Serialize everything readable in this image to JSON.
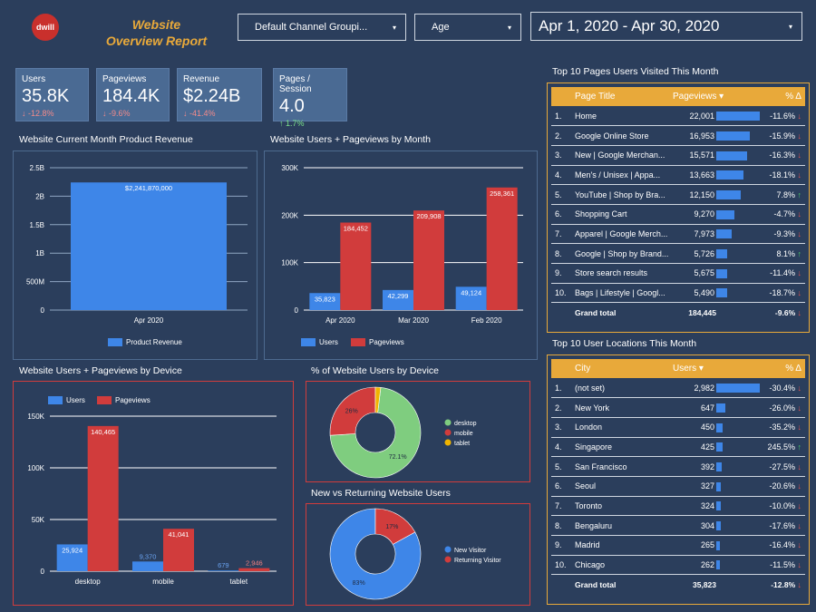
{
  "header": {
    "logo_text": "dwill",
    "title_line1": "Website",
    "title_line2": "Overview Report",
    "filter1": "Default Channel Groupi...",
    "filter2": "Age",
    "date_range": "Apr 1, 2020 - Apr 30, 2020",
    "caret": "▾"
  },
  "scorecards": [
    {
      "label": "Users",
      "value": "35.8K",
      "delta": "-12.8%",
      "dir": "down"
    },
    {
      "label": "Pageviews",
      "value": "184.4K",
      "delta": "-9.6%",
      "dir": "down"
    },
    {
      "label": "Revenue",
      "value": "$2.24B",
      "delta": "-41.4%",
      "dir": "down"
    },
    {
      "label": "Pages / Session",
      "value": "4.0",
      "delta": "1.7%",
      "dir": "up"
    }
  ],
  "pages_table": {
    "title": "Top 10 Pages Users Visited This Month",
    "col_title": "Page Title",
    "col_value": "Pageviews ▾",
    "col_delta": "% Δ",
    "max": 22001,
    "rows": [
      {
        "n": "1.",
        "name": "Home",
        "value": "22,001",
        "raw": 22001,
        "delta": "-11.6%",
        "dir": "down"
      },
      {
        "n": "2.",
        "name": "Google Online Store",
        "value": "16,953",
        "raw": 16953,
        "delta": "-15.9%",
        "dir": "down"
      },
      {
        "n": "3.",
        "name": "New | Google Merchan...",
        "value": "15,571",
        "raw": 15571,
        "delta": "-16.3%",
        "dir": "down"
      },
      {
        "n": "4.",
        "name": "Men's / Unisex | Appa...",
        "value": "13,663",
        "raw": 13663,
        "delta": "-18.1%",
        "dir": "down"
      },
      {
        "n": "5.",
        "name": "YouTube | Shop by Bra...",
        "value": "12,150",
        "raw": 12150,
        "delta": "7.8%",
        "dir": "up"
      },
      {
        "n": "6.",
        "name": "Shopping Cart",
        "value": "9,270",
        "raw": 9270,
        "delta": "-4.7%",
        "dir": "down"
      },
      {
        "n": "7.",
        "name": "Apparel | Google Merch...",
        "value": "7,973",
        "raw": 7973,
        "delta": "-9.3%",
        "dir": "down"
      },
      {
        "n": "8.",
        "name": "Google | Shop by Brand...",
        "value": "5,726",
        "raw": 5726,
        "delta": "8.1%",
        "dir": "up"
      },
      {
        "n": "9.",
        "name": "Store search results",
        "value": "5,675",
        "raw": 5675,
        "delta": "-11.4%",
        "dir": "down"
      },
      {
        "n": "10.",
        "name": "Bags | Lifestyle | Googl...",
        "value": "5,490",
        "raw": 5490,
        "delta": "-18.7%",
        "dir": "down"
      }
    ],
    "total_label": "Grand total",
    "total_value": "184,445",
    "total_delta": "-9.6%"
  },
  "locations_table": {
    "title": "Top 10 User Locations This Month",
    "col_title": "City",
    "col_value": "Users ▾",
    "col_delta": "% Δ",
    "max": 2982,
    "rows": [
      {
        "n": "1.",
        "name": "(not set)",
        "value": "2,982",
        "raw": 2982,
        "delta": "-30.4%",
        "dir": "down"
      },
      {
        "n": "2.",
        "name": "New York",
        "value": "647",
        "raw": 647,
        "delta": "-26.0%",
        "dir": "down"
      },
      {
        "n": "3.",
        "name": "London",
        "value": "450",
        "raw": 450,
        "delta": "-35.2%",
        "dir": "down"
      },
      {
        "n": "4.",
        "name": "Singapore",
        "value": "425",
        "raw": 425,
        "delta": "245.5%",
        "dir": "up"
      },
      {
        "n": "5.",
        "name": "San Francisco",
        "value": "392",
        "raw": 392,
        "delta": "-27.5%",
        "dir": "down"
      },
      {
        "n": "6.",
        "name": "Seoul",
        "value": "327",
        "raw": 327,
        "delta": "-20.6%",
        "dir": "down"
      },
      {
        "n": "7.",
        "name": "Toronto",
        "value": "324",
        "raw": 324,
        "delta": "-10.0%",
        "dir": "down"
      },
      {
        "n": "8.",
        "name": "Bengaluru",
        "value": "304",
        "raw": 304,
        "delta": "-17.6%",
        "dir": "down"
      },
      {
        "n": "9.",
        "name": "Madrid",
        "value": "265",
        "raw": 265,
        "delta": "-16.4%",
        "dir": "down"
      },
      {
        "n": "10.",
        "name": "Chicago",
        "value": "262",
        "raw": 262,
        "delta": "-11.5%",
        "dir": "down"
      }
    ],
    "total_label": "Grand total",
    "total_value": "35,823",
    "total_delta": "-12.8%"
  },
  "chart_titles": {
    "revenue": "Website Current Month Product Revenue",
    "monthly": "Website Users + Pageviews by Month",
    "device": "Website Users + Pageviews by Device",
    "device_pie": "% of Website Users by Device",
    "newret": "New vs Returning Website Users"
  },
  "chart_data": [
    {
      "type": "bar",
      "categories": [
        "Apr 2020"
      ],
      "series": [
        {
          "name": "Product Revenue",
          "values": [
            2241870000
          ],
          "labels": [
            "$2,241,870,000"
          ]
        }
      ],
      "yticks": [
        "0",
        "500M",
        "1B",
        "1.5B",
        "2B",
        "2.5B"
      ],
      "ylim": [
        0,
        2500000000
      ],
      "legend": "bottom"
    },
    {
      "type": "bar",
      "categories": [
        "Apr 2020",
        "Mar 2020",
        "Feb 2020"
      ],
      "series": [
        {
          "name": "Users",
          "values": [
            35823,
            42299,
            49124
          ],
          "labels": [
            "35,823",
            "42,299",
            "49,124"
          ]
        },
        {
          "name": "Pageviews",
          "values": [
            184452,
            209908,
            258361
          ],
          "labels": [
            "184,452",
            "209,908",
            "258,361"
          ]
        }
      ],
      "yticks": [
        "0",
        "100K",
        "200K",
        "300K"
      ],
      "ylim": [
        0,
        300000
      ],
      "legend": "bottom"
    },
    {
      "type": "bar",
      "categories": [
        "desktop",
        "mobile",
        "tablet"
      ],
      "series": [
        {
          "name": "Users",
          "values": [
            25924,
            9370,
            679
          ],
          "labels": [
            "25,924",
            "9,370",
            "679"
          ]
        },
        {
          "name": "Pageviews",
          "values": [
            140465,
            41041,
            2946
          ],
          "labels": [
            "140,465",
            "41,041",
            "2,946"
          ]
        }
      ],
      "yticks": [
        "0",
        "50K",
        "100K",
        "150K"
      ],
      "ylim": [
        0,
        150000
      ],
      "legend": "top"
    },
    {
      "type": "pie",
      "labels": [
        "desktop",
        "mobile",
        "tablet"
      ],
      "values": [
        72.1,
        26.0,
        1.9
      ],
      "slice_labels": [
        "72.1%",
        "26%",
        ""
      ],
      "colors": [
        "#7fcd7f",
        "#d13c3c",
        "#f0b400"
      ],
      "legend": "right"
    },
    {
      "type": "pie",
      "labels": [
        "New Visitor",
        "Returning Visitor"
      ],
      "values": [
        83,
        17
      ],
      "slice_labels": [
        "83%",
        "17%"
      ],
      "colors": [
        "#3e86e8",
        "#d13c3c"
      ],
      "legend": "right"
    }
  ],
  "colors": {
    "background": "#2b3e5c",
    "users": "#3e86e8",
    "pageviews": "#d13c3c",
    "accent": "#e8a93a",
    "card": "#4a6a93"
  }
}
